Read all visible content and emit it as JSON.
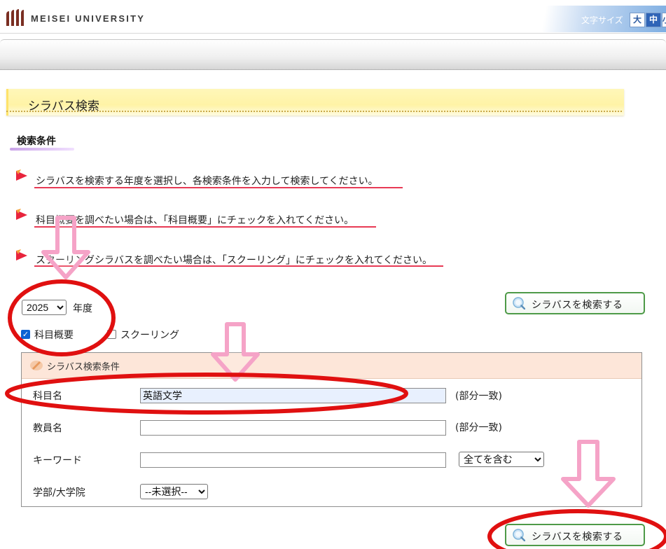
{
  "header": {
    "logo_text": "MEISEI UNIVERSITY",
    "font_size_label": "文字サイズ",
    "font_size_large": "大",
    "font_size_medium": "中",
    "font_size_small": "小"
  },
  "page": {
    "title": "シラバス検索",
    "section_heading": "検索条件"
  },
  "notes": [
    "シラバスを検索する年度を選択し、各検索条件を入力して検索してください。",
    "科目概要を調べたい場合は、「科目概要」にチェックを入れてください。",
    "スクーリングシラバスを調べたい場合は、「スクーリング」にチェックを入れてください。"
  ],
  "year_select": {
    "value": "2025",
    "suffix": "年度"
  },
  "checkboxes": {
    "overview": {
      "label": "科目概要",
      "checked": true
    },
    "schooling": {
      "label": "スクーリング",
      "checked": false
    }
  },
  "search_button": {
    "label": "シラバスを検索する"
  },
  "panel": {
    "title": "シラバス検索条件",
    "fields": {
      "subject": {
        "label": "科目名",
        "value": "英語文学",
        "hint": "(部分一致)"
      },
      "teacher": {
        "label": "教員名",
        "value": "",
        "hint": "(部分一致)"
      },
      "keyword": {
        "label": "キーワード",
        "value": "",
        "mode": "全てを含む"
      },
      "faculty": {
        "label": "学部/大学院",
        "value": "--未選択--"
      }
    }
  },
  "colors": {
    "annotation_arrow": "#f5a3c7",
    "annotation_circle": "#e01010",
    "note_underline": "#e83a55",
    "button_border": "#4e9a48",
    "panel_header": "#fde6d9",
    "title_banner": "#fff4a8"
  }
}
